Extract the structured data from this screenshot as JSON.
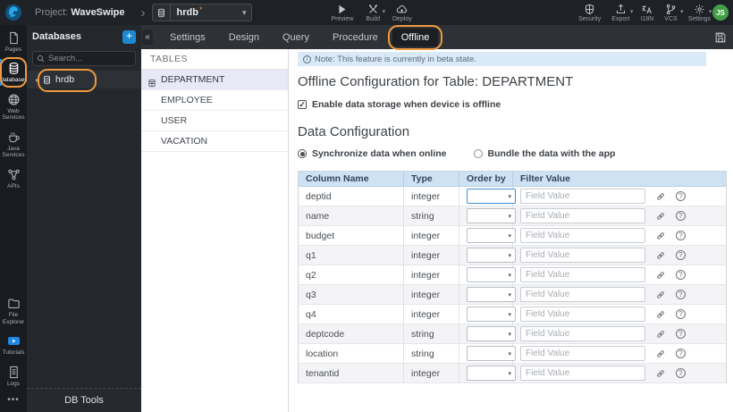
{
  "topbar": {
    "project_prefix": "Project:",
    "project_name": "WaveSwipe",
    "db_selector": {
      "value": "hrdb",
      "modified_indicator": "*"
    },
    "actions": [
      {
        "label": "Preview",
        "icon": "play-icon",
        "has_caret": false
      },
      {
        "label": "Build",
        "icon": "build-icon",
        "has_caret": true
      },
      {
        "label": "Deploy",
        "icon": "deploy-icon",
        "has_caret": false
      }
    ],
    "right_actions": [
      {
        "label": "Security",
        "icon": "shield-icon",
        "has_caret": false
      },
      {
        "label": "Export",
        "icon": "export-icon",
        "has_caret": true
      },
      {
        "label": "I18N",
        "icon": "i18n-icon",
        "has_caret": false
      },
      {
        "label": "VCS",
        "icon": "vcs-icon",
        "has_caret": true
      },
      {
        "label": "Settings",
        "icon": "gear-icon",
        "has_caret": true
      }
    ],
    "avatar_initials": "JS"
  },
  "rail": {
    "items": [
      {
        "label": "Pages",
        "icon": "page-icon",
        "active": false,
        "annotated": false,
        "bottom": false
      },
      {
        "label": "Databases",
        "icon": "database-icon",
        "active": true,
        "annotated": true,
        "bottom": false
      },
      {
        "label": "Web Services",
        "icon": "globe-icon",
        "active": false,
        "annotated": false,
        "bottom": false
      },
      {
        "label": "Java Services",
        "icon": "coffee-icon",
        "active": false,
        "annotated": false,
        "bottom": false
      },
      {
        "label": "APIs",
        "icon": "api-icon",
        "active": false,
        "annotated": false,
        "bottom": false
      },
      {
        "label": "File Explorer",
        "icon": "folder-icon",
        "active": false,
        "annotated": false,
        "bottom": true
      },
      {
        "label": "Tutorials",
        "icon": "video-icon",
        "active": false,
        "annotated": false,
        "bottom": true
      },
      {
        "label": "Logs",
        "icon": "logs-icon",
        "active": false,
        "annotated": false,
        "bottom": true
      }
    ]
  },
  "db_panel": {
    "title": "Databases",
    "add_button": "+",
    "search_placeholder": "Search...",
    "items": [
      {
        "label": "hrdb",
        "annotated": true
      }
    ],
    "footer_label": "DB Tools"
  },
  "tab_bar": {
    "tabs": [
      {
        "label": "Settings",
        "active": false,
        "annotated": false
      },
      {
        "label": "Design",
        "active": false,
        "annotated": false
      },
      {
        "label": "Query",
        "active": false,
        "annotated": false
      },
      {
        "label": "Procedure",
        "active": false,
        "annotated": false
      },
      {
        "label": "Offline",
        "active": true,
        "annotated": true
      }
    ]
  },
  "tables_panel": {
    "title": "TABLES",
    "items": [
      {
        "label": "DEPARTMENT",
        "selected": true
      },
      {
        "label": "EMPLOYEE",
        "selected": false
      },
      {
        "label": "USER",
        "selected": false
      },
      {
        "label": "VACATION",
        "selected": false
      }
    ]
  },
  "main": {
    "note": "Note: This feature is currently in beta state.",
    "title": "Offline Configuration for Table: DEPARTMENT",
    "enable_offline": {
      "label": "Enable data storage when device is offline",
      "checked": true
    },
    "section_title": "Data Configuration",
    "sync_options": [
      {
        "label": "Synchronize data when online",
        "selected": true
      },
      {
        "label": "Bundle the data with the app",
        "selected": false
      }
    ],
    "table": {
      "headers": [
        "Column Name",
        "Type",
        "Order by",
        "Filter Value"
      ],
      "filter_placeholder": "Field Value",
      "rows": [
        {
          "column_name": "deptid",
          "type": "integer"
        },
        {
          "column_name": "name",
          "type": "string"
        },
        {
          "column_name": "budget",
          "type": "integer"
        },
        {
          "column_name": "q1",
          "type": "integer"
        },
        {
          "column_name": "q2",
          "type": "integer"
        },
        {
          "column_name": "q3",
          "type": "integer"
        },
        {
          "column_name": "q4",
          "type": "integer"
        },
        {
          "column_name": "deptcode",
          "type": "string"
        },
        {
          "column_name": "location",
          "type": "string"
        },
        {
          "column_name": "tenantid",
          "type": "integer"
        }
      ]
    }
  },
  "colors": {
    "annotation_orange": "#ee9a3f",
    "accent_blue": "#2b8fd8",
    "note_bg": "#d9e9f7",
    "table_header_bg": "#cde2f3",
    "avatar_green": "#43a047",
    "topbar_bg": "#1e2126"
  }
}
